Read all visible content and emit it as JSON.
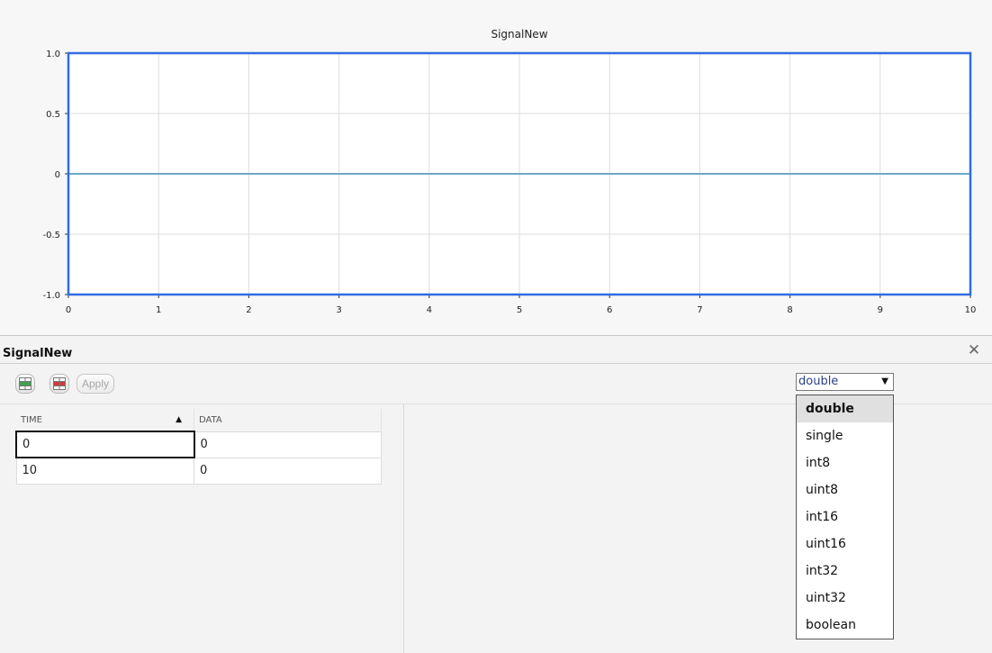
{
  "chart_data": {
    "type": "line",
    "title": "SignalNew",
    "xlabel": "",
    "ylabel": "",
    "xlim": [
      0,
      10
    ],
    "ylim": [
      -1.0,
      1.0
    ],
    "x_ticks": [
      "0",
      "1",
      "2",
      "3",
      "4",
      "5",
      "6",
      "7",
      "8",
      "9",
      "10"
    ],
    "y_ticks": [
      "1.0",
      "0.5",
      "0",
      "-0.5",
      "-1.0"
    ],
    "grid": true,
    "series": [
      {
        "x": [
          0,
          10
        ],
        "y": [
          0,
          0
        ],
        "color": "#6fa8c9"
      }
    ],
    "frame_color": "#2f6de2"
  },
  "editor": {
    "title": "SignalNew",
    "close_glyph": "✕",
    "apply_label": "Apply",
    "toolbar_icons": [
      "insert-row-icon",
      "delete-row-icon"
    ],
    "table": {
      "columns": [
        "TIME",
        "DATA"
      ],
      "rows": [
        [
          "0",
          "0"
        ],
        [
          "10",
          "0"
        ]
      ],
      "sort_glyph": "▲"
    },
    "datatype": {
      "selected": "double",
      "arrow": "▼",
      "options": [
        "double",
        "single",
        "int8",
        "uint8",
        "int16",
        "uint16",
        "int32",
        "uint32",
        "boolean"
      ]
    }
  }
}
